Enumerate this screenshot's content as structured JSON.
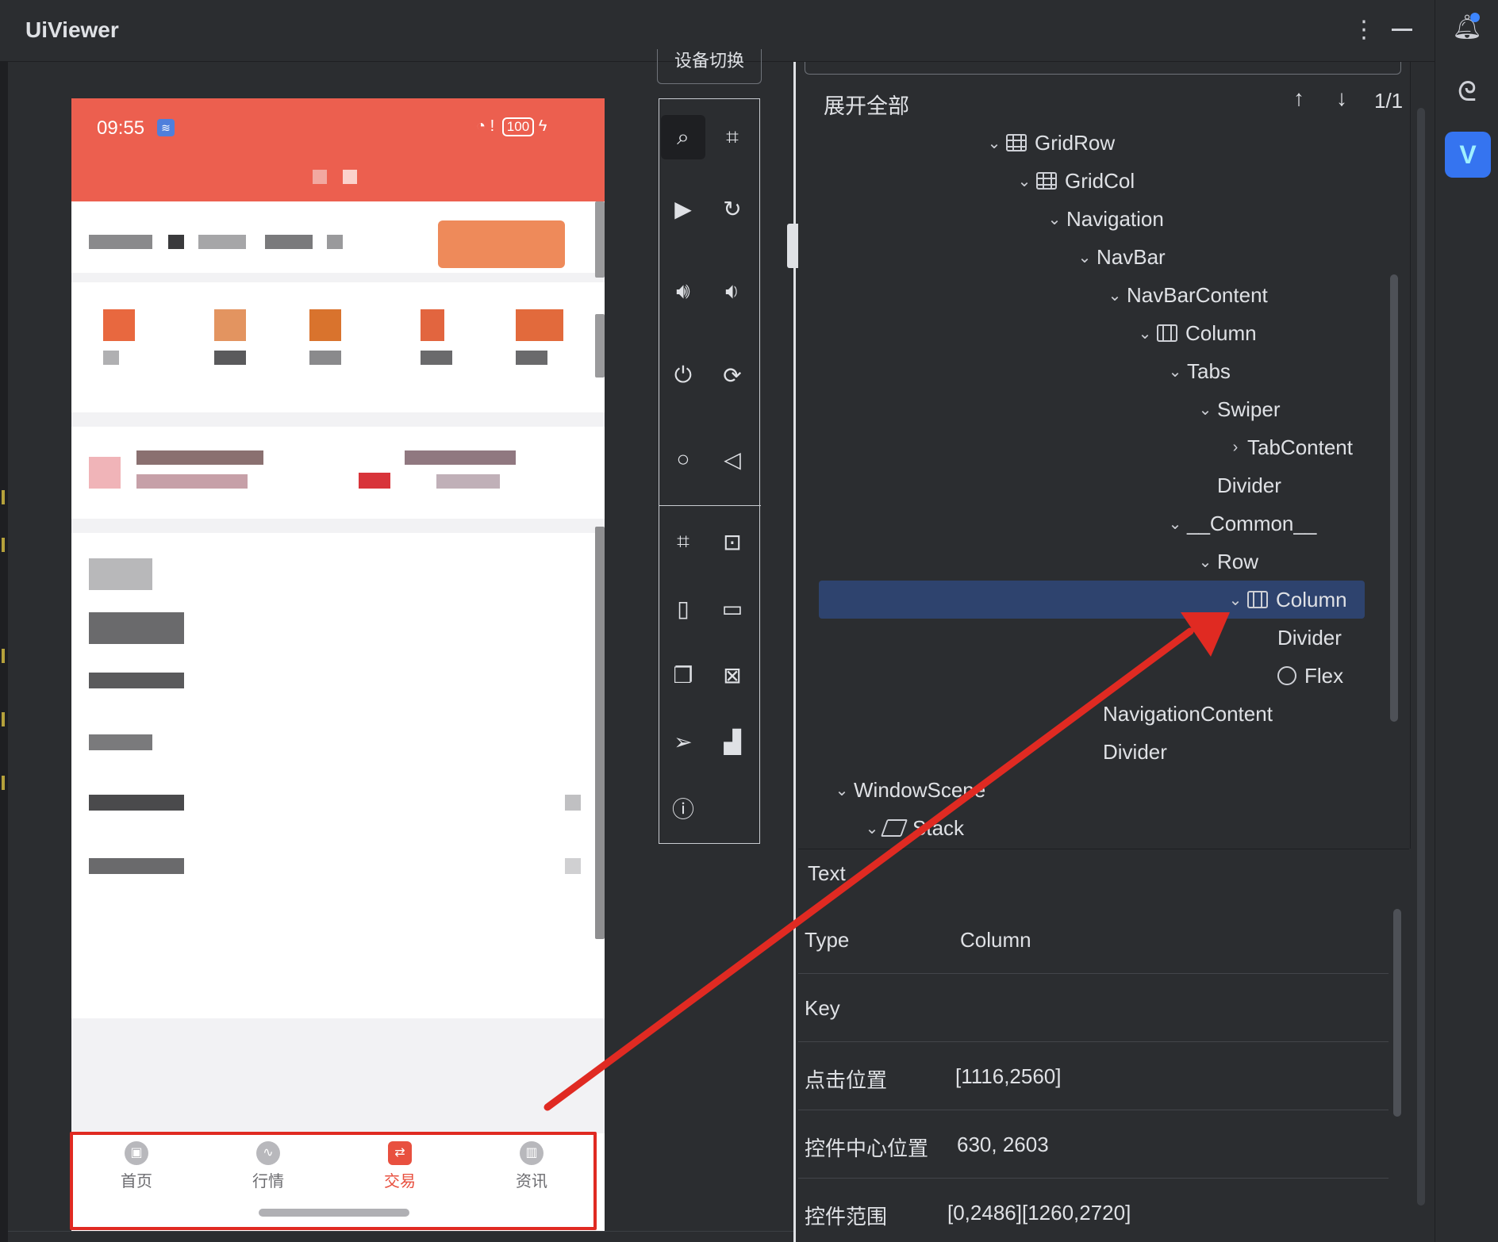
{
  "window": {
    "title": "UiViewer",
    "menu_icon": "⋮"
  },
  "phone": {
    "status_time": "09:55",
    "battery": "100",
    "tabs": [
      {
        "label": "首页",
        "icon": "briefcase-icon",
        "active": false
      },
      {
        "label": "行情",
        "icon": "chart-trend-icon",
        "active": false
      },
      {
        "label": "交易",
        "icon": "exchange-icon",
        "active": true
      },
      {
        "label": "资讯",
        "icon": "bar-chart-icon",
        "active": false
      }
    ]
  },
  "toolbar": {
    "device_switch_label": "设备切换"
  },
  "tree": {
    "expand_all_label": "展开全部",
    "search_count": "1/1",
    "nodes": [
      {
        "label": "GridRow",
        "icon": "grid-icon",
        "expanded": true
      },
      {
        "label": "GridCol",
        "icon": "grid-icon",
        "expanded": true
      },
      {
        "label": "Navigation",
        "icon": "",
        "expanded": true
      },
      {
        "label": "NavBar",
        "icon": "",
        "expanded": true
      },
      {
        "label": "NavBarContent",
        "icon": "",
        "expanded": true
      },
      {
        "label": "Column",
        "icon": "column-icon",
        "expanded": true
      },
      {
        "label": "Tabs",
        "icon": "",
        "expanded": true
      },
      {
        "label": "Swiper",
        "icon": "",
        "expanded": true
      },
      {
        "label": "TabContent",
        "icon": "",
        "expanded": false
      },
      {
        "label": "Divider",
        "icon": "",
        "expanded": null
      },
      {
        "label": "__Common__",
        "icon": "",
        "expanded": true
      },
      {
        "label": "Row",
        "icon": "",
        "expanded": true
      },
      {
        "label": "Column",
        "icon": "column-icon",
        "expanded": true,
        "selected": true
      },
      {
        "label": "Divider",
        "icon": "",
        "expanded": null
      },
      {
        "label": "Flex",
        "icon": "cube-icon",
        "expanded": null
      },
      {
        "label": "NavigationContent",
        "icon": "",
        "expanded": null
      },
      {
        "label": "Divider",
        "icon": "",
        "expanded": null
      },
      {
        "label": "WindowScene",
        "icon": "",
        "expanded": true
      },
      {
        "label": "Stack",
        "icon": "stack-icon",
        "expanded": true
      }
    ]
  },
  "properties": {
    "header": "Text",
    "rows": [
      {
        "key": "Type",
        "value": "Column"
      },
      {
        "key": "Key",
        "value": ""
      },
      {
        "key": "点击位置",
        "value": "[1116,2560]"
      },
      {
        "key": "控件中心位置",
        "value": "630, 2603"
      },
      {
        "key": "控件范围",
        "value": "[0,2486][1260,2720]"
      }
    ]
  },
  "colors": {
    "accent_red": "#ec5f4f",
    "selection": "#2e436e",
    "annotation": "#e02a22"
  }
}
